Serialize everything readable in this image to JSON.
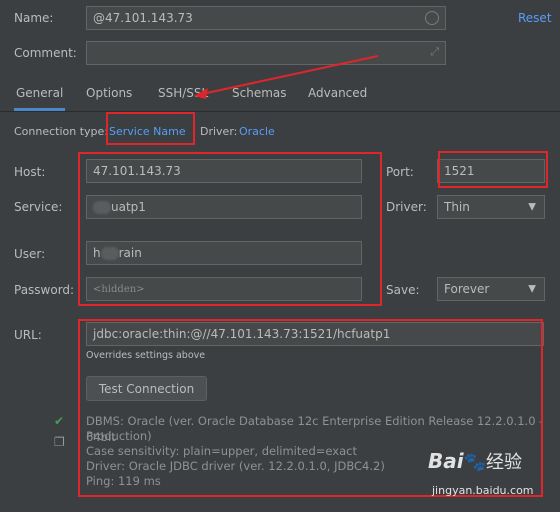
{
  "name_row": {
    "label": "Name:",
    "value": "@47.101.143.73",
    "reset_label": "Reset"
  },
  "comment_row": {
    "label": "Comment:",
    "value": ""
  },
  "tabs": [
    {
      "label": "General"
    },
    {
      "label": "Options"
    },
    {
      "label": "SSH/SSL"
    },
    {
      "label": "Schemas"
    },
    {
      "label": "Advanced"
    }
  ],
  "connection": {
    "type_label": "Connection type:",
    "type_value": "Service Name",
    "driver_label": "Driver:",
    "driver_value": "Oracle"
  },
  "fields": {
    "host_label": "Host:",
    "host_value": "47.101.143.73",
    "port_label": "Port:",
    "port_value": "1521",
    "service_label": "Service:",
    "service_value": "uatp1",
    "driver_label": "Driver:",
    "driver_value": "Thin",
    "user_label": "User:",
    "user_value_prefix": "h",
    "user_value_suffix": "rain",
    "password_label": "Password:",
    "password_value": "<hidden>",
    "save_label": "Save:",
    "save_value": "Forever"
  },
  "url": {
    "label": "URL:",
    "value": "jdbc:oracle:thin:@//47.101.143.73:1521/hcfuatp1",
    "hint": "Overrides settings above"
  },
  "test_connection_label": "Test Connection",
  "result": {
    "dbms": "DBMS: Oracle (ver. Oracle Database 12c Enterprise Edition Release 12.2.0.1.0 - 64bit",
    "dbms_cont": "Production)",
    "case": "Case sensitivity: plain=upper, delimited=exact",
    "driver": "Driver: Oracle JDBC driver (ver. 12.2.0.1.0, JDBC4.2)",
    "ping": "Ping: 119 ms"
  },
  "watermark": {
    "brand": "Bai",
    "brand2": "经验",
    "site": "jingyan.baidu.com"
  },
  "colors": {
    "background": "#3c3f41",
    "link": "#589df6",
    "annotation": "#e0252b",
    "success": "#499c54"
  }
}
